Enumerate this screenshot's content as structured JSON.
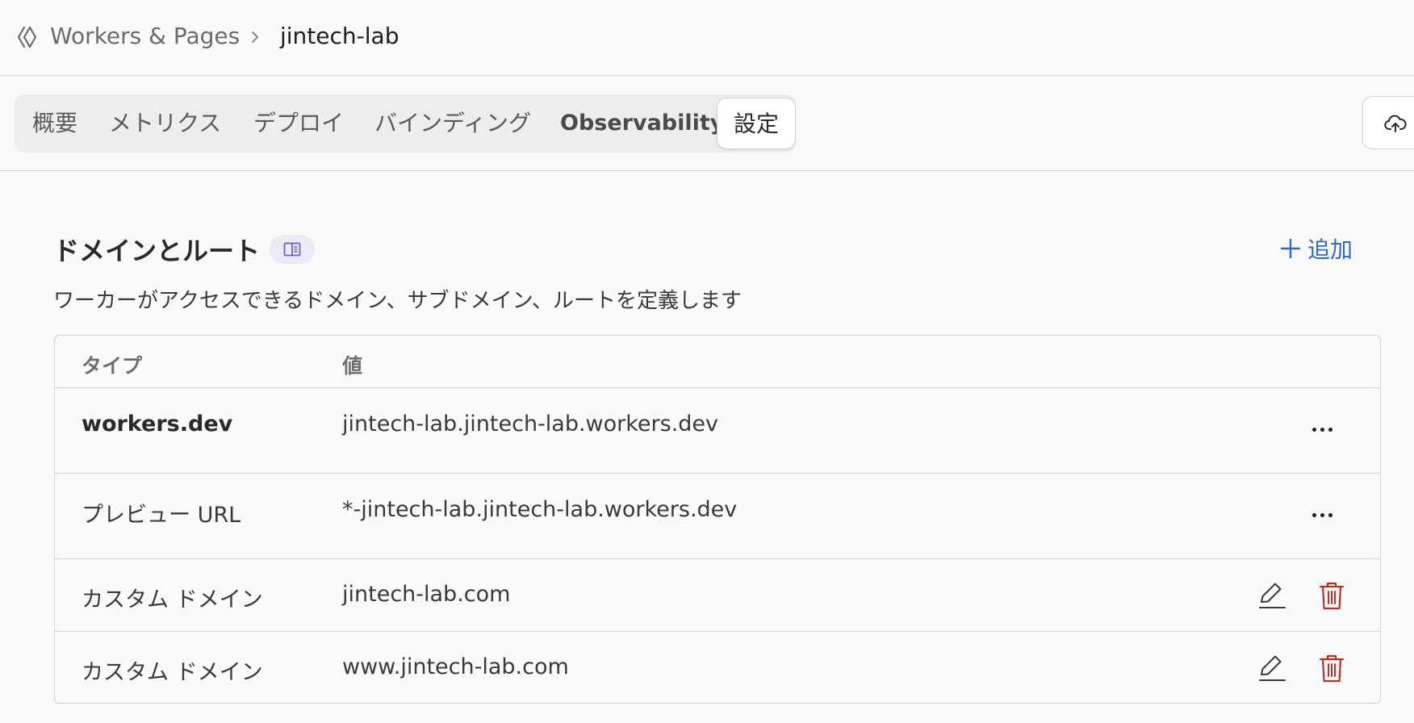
{
  "breadcrumb": {
    "parent": "Workers & Pages",
    "current": "jintech-lab"
  },
  "tabs": [
    {
      "label": "概要"
    },
    {
      "label": "メトリクス"
    },
    {
      "label": "デプロイ"
    },
    {
      "label": "バインディング"
    },
    {
      "label": "Observability"
    },
    {
      "label": "設定",
      "active": true
    }
  ],
  "section": {
    "title": "ドメインとルート",
    "add_label": "追加",
    "description": "ワーカーがアクセスできるドメイン、サブドメイン、ルートを定義します"
  },
  "table": {
    "headers": {
      "type": "タイプ",
      "value": "値"
    },
    "rows": [
      {
        "type": "workers.dev",
        "value": "jintech-lab.jintech-lab.workers.dev",
        "actions": "more"
      },
      {
        "type": "プレビュー URL",
        "value": "*-jintech-lab.jintech-lab.workers.dev",
        "actions": "more"
      },
      {
        "type": "カスタム ドメイン",
        "value": "jintech-lab.com",
        "actions": "edit-delete"
      },
      {
        "type": "カスタム ドメイン",
        "value": "www.jintech-lab.com",
        "actions": "edit-delete"
      }
    ]
  },
  "colors": {
    "accent": "#2f66d0",
    "danger": "#b0342a",
    "background": "#f9f9f9"
  },
  "icons": {
    "breadcrumb": "workers-icon",
    "separator": "chevron-right-icon",
    "deploy": "cloud-upload-icon",
    "docs": "book-icon",
    "add": "plus-icon",
    "more": "ellipsis-icon",
    "edit": "pencil-icon",
    "delete": "trash-icon"
  }
}
